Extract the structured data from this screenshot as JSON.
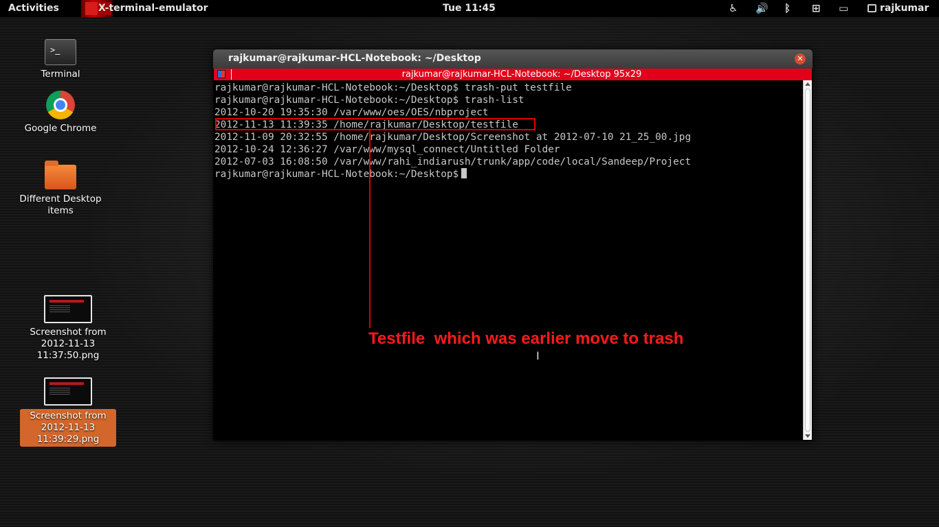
{
  "topbar": {
    "activities": "Activities",
    "app_name": "X-terminal-emulator",
    "clock": "Tue 11:45",
    "user": "rajkumar",
    "icons": [
      "accessibility-icon",
      "volume-icon",
      "bluetooth-icon",
      "network-icon",
      "battery-icon",
      "user-icon"
    ]
  },
  "desktop": {
    "items": [
      {
        "label": "Terminal",
        "icon": "terminal-icon"
      },
      {
        "label": "Google Chrome",
        "icon": "chrome-icon"
      },
      {
        "label": "Different Desktop items",
        "icon": "folder-icon"
      },
      {
        "label": "Screenshot from 2012-11-13 11:37:50.png",
        "icon": "image-thumbnail-icon"
      },
      {
        "label": "Screenshot from 2012-11-13 11:39:29.png",
        "icon": "image-thumbnail-icon",
        "selected": true
      }
    ]
  },
  "window": {
    "title": "rajkumar@rajkumar-HCL-Notebook: ~/Desktop",
    "terminal_caption": "rajkumar@rajkumar-HCL-Notebook: ~/Desktop 95x29",
    "lines": [
      "rajkumar@rajkumar-HCL-Notebook:~/Desktop$ trash-put testfile",
      "rajkumar@rajkumar-HCL-Notebook:~/Desktop$ trash-list",
      "2012-10-20 19:35:30 /var/www/oes/OES/nbproject",
      "2012-11-13 11:39:35 /home/rajkumar/Desktop/testfile",
      "2012-11-09 20:32:55 /home/rajkumar/Desktop/Screenshot at 2012-07-10 21_25_00.jpg",
      "2012-10-24 12:36:27 /var/www/mysql_connect/Untitled Folder",
      "2012-07-03 16:08:50 /var/www/rahi_indiarush/trunk/app/code/local/Sandeep/Project",
      "rajkumar@rajkumar-HCL-Notebook:~/Desktop$"
    ]
  },
  "annotation": {
    "text": "Testfile  which was earlier move to trash",
    "color": "#ff1a1a"
  },
  "colors": {
    "accent_red": "#e3001b",
    "selection_orange": "#d2662b"
  }
}
